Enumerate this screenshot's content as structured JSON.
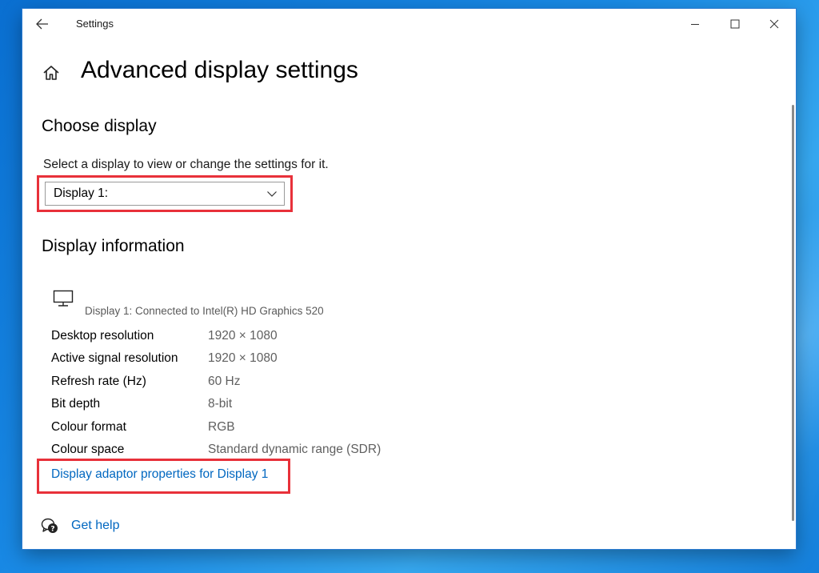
{
  "window": {
    "app_title": "Settings",
    "accent_color": "#0067c0",
    "highlight_color": "#e8313a"
  },
  "page": {
    "title": "Advanced display settings"
  },
  "choose_display": {
    "heading": "Choose display",
    "description": "Select a display to view or change the settings for it.",
    "selected_display": "Display 1:"
  },
  "display_info": {
    "heading": "Display information",
    "monitor_caption": "Display 1: Connected to Intel(R) HD Graphics 520",
    "rows": [
      {
        "label": "Desktop resolution",
        "value": "1920 × 1080"
      },
      {
        "label": "Active signal resolution",
        "value": "1920 × 1080"
      },
      {
        "label": "Refresh rate (Hz)",
        "value": "60 Hz"
      },
      {
        "label": "Bit depth",
        "value": "8-bit"
      },
      {
        "label": "Colour format",
        "value": "RGB"
      },
      {
        "label": "Colour space",
        "value": "Standard dynamic range (SDR)"
      }
    ],
    "adapter_link": "Display adaptor properties for Display 1"
  },
  "help": {
    "label": "Get help"
  },
  "icons": {
    "back": "back-arrow-icon",
    "minimize": "minimize-icon",
    "maximize": "maximize-icon",
    "close": "close-icon",
    "home": "home-icon",
    "chevron": "chevron-down-icon",
    "monitor": "monitor-icon",
    "help": "help-chat-icon"
  }
}
